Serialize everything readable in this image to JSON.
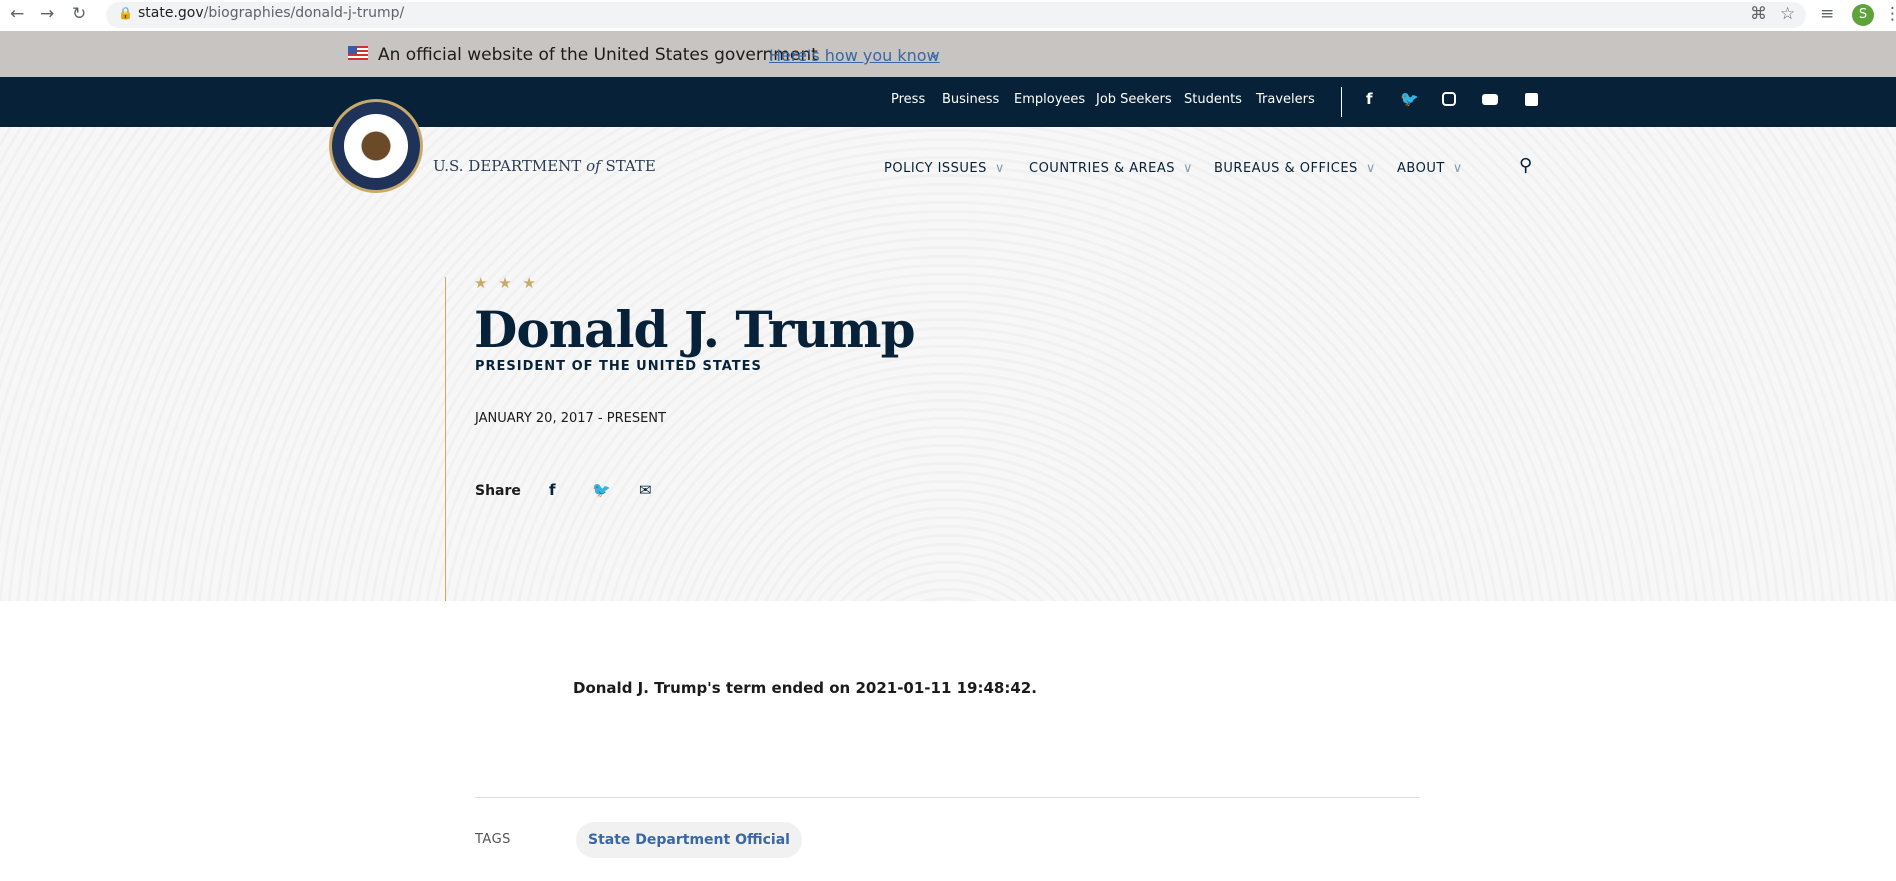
{
  "browser": {
    "url_host": "state.gov",
    "url_path": "/biographies/donald-j-trump/",
    "profile_initial": "S"
  },
  "banner": {
    "text": "An official website of the United States government",
    "link": "Here's how you know"
  },
  "top_nav": {
    "links": [
      "Press",
      "Business",
      "Employees",
      "Job Seekers",
      "Students",
      "Travelers"
    ],
    "social_icons": [
      "facebook-icon",
      "twitter-icon",
      "instagram-icon",
      "youtube-icon",
      "flickr-icon"
    ]
  },
  "header": {
    "logo_text_a": "U.S. DEPARTMENT ",
    "logo_text_of": "of",
    "logo_text_b": " STATE",
    "menu": [
      "POLICY ISSUES",
      "COUNTRIES & AREAS",
      "BUREAUS & OFFICES",
      "ABOUT"
    ]
  },
  "hero": {
    "stars": "★ ★ ★",
    "title": "Donald J. Trump",
    "subtitle": "PRESIDENT OF THE UNITED STATES",
    "dates": "JANUARY 20, 2017 - PRESENT",
    "share_label": "Share"
  },
  "body": {
    "term_text": "Donald J. Trump's term ended on 2021-01-11 19:48:42."
  },
  "tags": {
    "label": "TAGS",
    "items": [
      "State Department Official"
    ]
  },
  "colors": {
    "navy": "#072238",
    "gold": "#c9a96a",
    "banner": "#c8c4c2",
    "link": "#3a67a5"
  }
}
